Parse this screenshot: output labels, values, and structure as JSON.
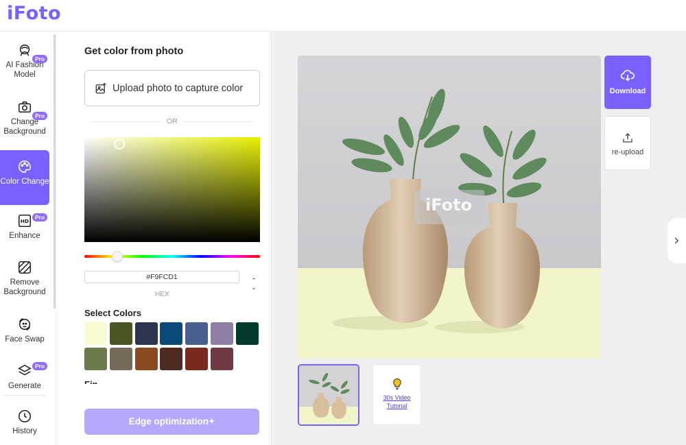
{
  "app": {
    "logo": "iFoto",
    "accent": "#7b61ff"
  },
  "sidebar": {
    "items": [
      {
        "label": "AI Fashion Model",
        "icon": "fashion-model-icon",
        "pro": true,
        "active": false
      },
      {
        "label": "Change Background",
        "icon": "camera-icon",
        "pro": true,
        "active": false
      },
      {
        "label": "Color Change",
        "icon": "palette-icon",
        "pro": false,
        "active": true
      },
      {
        "label": "Enhance",
        "icon": "hd-icon",
        "pro": true,
        "active": false
      },
      {
        "label": "Remove Background",
        "icon": "remove-bg-icon",
        "pro": false,
        "active": false
      },
      {
        "label": "Face Swap",
        "icon": "face-swap-icon",
        "pro": false,
        "active": false
      },
      {
        "label": "Generate",
        "icon": "layers-icon",
        "pro": true,
        "active": false
      },
      {
        "label": "History",
        "icon": "clock-icon",
        "pro": false,
        "active": false
      }
    ],
    "pro_badge": "Pro"
  },
  "panel": {
    "title": "Get color from photo",
    "upload_label": "Upload photo to capture color",
    "or_text": "OR",
    "hex_value": "#F9FCD1",
    "hex_label": "HEX",
    "select_colors_title": "Select Colors",
    "swatches": [
      "#f9fcd1",
      "#4a5624",
      "#2c3650",
      "#0a4a78",
      "#4a5f8e",
      "#8f7ea3",
      "#053a2e",
      "#6b7a4a",
      "#776b5c",
      "#8c4a20",
      "#4e2a22",
      "#7a2a1c",
      "#6e3a44"
    ],
    "edge_button": "Edge optimization"
  },
  "main": {
    "watermark": "iFoto",
    "download_label": "Download",
    "reupload_label": "re-upload",
    "tutorial_label": "30s Video Tutorial"
  }
}
